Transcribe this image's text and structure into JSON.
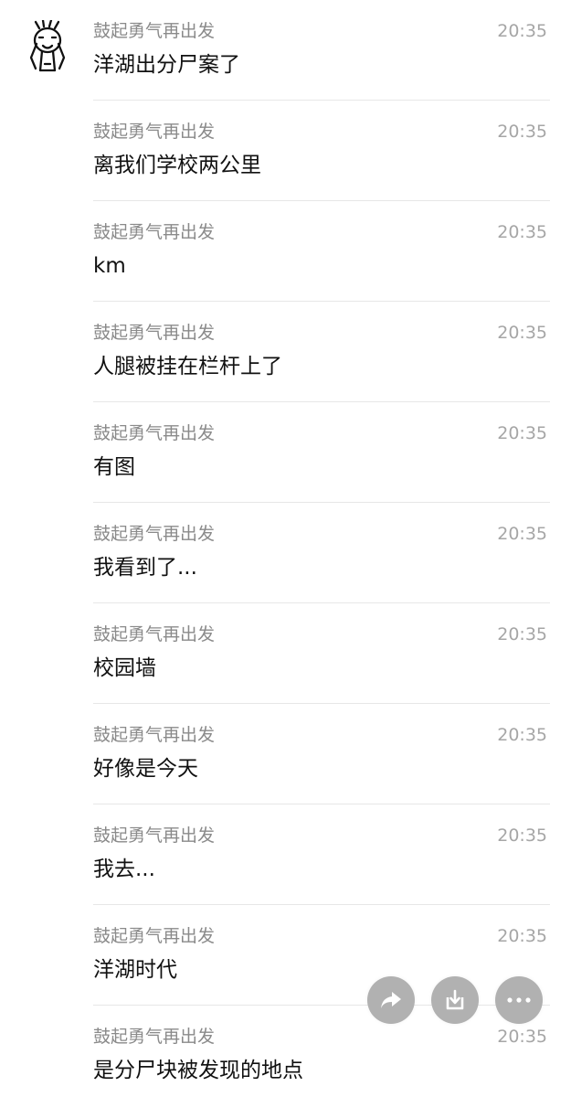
{
  "sender_name": "鼓起勇气再出发",
  "time": "20:35",
  "messages": [
    {
      "text": "洋湖出分尸案了"
    },
    {
      "text": "离我们学校两公里"
    },
    {
      "text": "km"
    },
    {
      "text": "人腿被挂在栏杆上了"
    },
    {
      "text": "有图"
    },
    {
      "text": "我看到了..."
    },
    {
      "text": "校园墙"
    },
    {
      "text": "好像是今天"
    },
    {
      "text": "我去..."
    },
    {
      "text": "洋湖时代"
    },
    {
      "text": "是分尸块被发现的地点"
    }
  ],
  "icons": {
    "share": "share-arrow-icon",
    "save": "download-icon",
    "more": "more-dots-icon"
  },
  "colors": {
    "action_button": "#b1b1b1",
    "divider": "#e7e7e7",
    "sender": "#8a8a8a",
    "time": "#a6a6a6",
    "message": "#111111"
  }
}
